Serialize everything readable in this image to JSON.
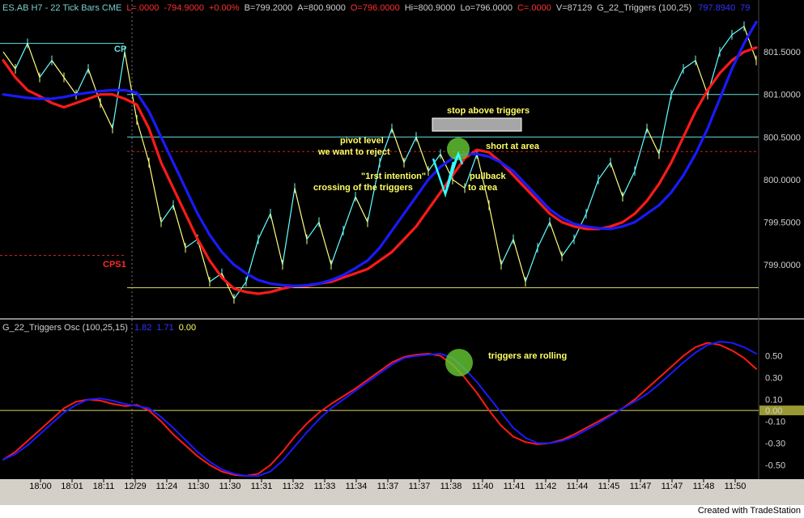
{
  "header": {
    "symbol": "ES.AB H7 - 22 Tick Bars  CME",
    "last": "L=.0000",
    "change": "-794.9000",
    "pct": "+0.00%",
    "bid": "B=799.2000",
    "ask": "A=800.9000",
    "open": "O=796.0000",
    "high": "Hi=800.9000",
    "low": "Lo=796.0000",
    "close": "C=.0000",
    "volume": "V=87129",
    "study": "G_22_Triggers  (100,25)",
    "study_v1": "797.8940",
    "study_v2": "79"
  },
  "osc_header": {
    "title": "G_22_Triggers Osc  (100,25,15)",
    "v1": "1.82",
    "v2": "1.71",
    "v3": "0.00"
  },
  "footer": {
    "credit": "Created with TradeStation"
  },
  "colors": {
    "bg": "#000000",
    "price_up": "#66ffff",
    "price_down": "#ffff80",
    "trigger_fast": "#ff1a1a",
    "trigger_slow": "#1a1aff",
    "level_cyan": "#66e0e0",
    "level_yellow": "#d8d860",
    "pivot_red": "#cc2222",
    "highlight_green": "#66cc33"
  },
  "chart_data": [
    {
      "type": "line",
      "panel": "price",
      "price_axis": [
        "801.5000",
        "801.0000",
        "800.5000",
        "800.0000",
        "799.5000",
        "799.0000"
      ],
      "time_axis": [
        "18:00",
        "18:01",
        "18:11",
        "12/29",
        "11:24",
        "11:30",
        "11:30",
        "11:31",
        "11:32",
        "11:33",
        "11:34",
        "11:37",
        "11:37",
        "11:38",
        "11:40",
        "11:41",
        "11:42",
        "11:44",
        "11:45",
        "11:47",
        "11:47",
        "11:48",
        "11:50"
      ],
      "ylim": [
        798.45,
        801.9
      ],
      "levels": [
        {
          "label": "CP",
          "price": 801.6,
          "style": "solid",
          "color": "#66e0e0",
          "extent": "left"
        },
        {
          "label": "",
          "price": 801.0,
          "style": "solid",
          "color": "#66e0e0",
          "extent": "right"
        },
        {
          "label": "",
          "price": 800.5,
          "style": "solid",
          "color": "#66e0e0",
          "extent": "right"
        },
        {
          "label": "",
          "price": 800.33,
          "style": "dashed",
          "color": "#cc2222",
          "extent": "right"
        },
        {
          "label": "CPS1",
          "price": 799.11,
          "style": "dashed",
          "color": "#cc2222",
          "extent": "left"
        },
        {
          "label": "",
          "price": 798.73,
          "style": "solid",
          "color": "#d8d860",
          "extent": "right"
        }
      ],
      "series": [
        {
          "color": "#ff1a1a",
          "values": [
            801.4,
            801.2,
            801.05,
            800.98,
            800.9,
            800.85,
            800.9,
            800.95,
            801.0,
            801.0,
            800.95,
            800.88,
            800.6,
            800.2,
            799.9,
            799.6,
            799.3,
            799.05,
            798.85,
            798.72,
            798.68,
            798.66,
            798.68,
            798.72,
            798.75,
            798.75,
            798.78,
            798.8,
            798.85,
            798.9,
            798.95,
            799.05,
            799.15,
            799.3,
            799.45,
            799.65,
            799.85,
            800.05,
            800.25,
            800.35,
            800.32,
            800.2,
            800.05,
            799.9,
            799.75,
            799.6,
            799.5,
            799.45,
            799.42,
            799.42,
            799.45,
            799.5,
            799.6,
            799.75,
            799.95,
            800.2,
            800.5,
            800.8,
            801.05,
            801.25,
            801.4,
            801.5,
            801.55
          ]
        },
        {
          "color": "#1a1aff",
          "values": [
            801.0,
            800.98,
            800.96,
            800.95,
            800.95,
            800.97,
            801.0,
            801.02,
            801.04,
            801.05,
            801.05,
            801.02,
            800.8,
            800.5,
            800.2,
            799.9,
            799.6,
            799.35,
            799.15,
            799.0,
            798.9,
            798.82,
            798.78,
            798.76,
            798.75,
            798.76,
            798.78,
            798.82,
            798.88,
            798.96,
            799.05,
            799.2,
            799.4,
            799.6,
            799.8,
            800.0,
            800.15,
            800.25,
            800.3,
            800.3,
            800.27,
            800.2,
            800.1,
            799.95,
            799.8,
            799.65,
            799.55,
            799.48,
            799.45,
            799.43,
            799.42,
            799.45,
            799.5,
            799.6,
            799.7,
            799.85,
            800.05,
            800.3,
            800.6,
            800.95,
            801.3,
            801.6,
            801.85
          ]
        },
        {
          "color": "#66ffff",
          "values": [
            801.5,
            801.3,
            801.6,
            801.2,
            801.4,
            801.2,
            801.0,
            801.3,
            800.9,
            800.6,
            801.5,
            800.7,
            800.2,
            799.5,
            799.7,
            799.2,
            799.3,
            798.8,
            798.9,
            798.6,
            798.8,
            799.3,
            799.6,
            799.0,
            799.9,
            799.3,
            799.5,
            799.0,
            799.4,
            799.8,
            799.5,
            800.2,
            800.6,
            800.2,
            800.5,
            800.1,
            800.3,
            800.0,
            799.9,
            800.3,
            799.7,
            799.0,
            799.3,
            798.8,
            799.2,
            799.5,
            799.1,
            799.3,
            799.6,
            800.0,
            800.2,
            799.8,
            800.1,
            800.6,
            800.3,
            801.0,
            801.3,
            801.4,
            801.0,
            801.5,
            801.7,
            801.8,
            801.4
          ]
        }
      ]
    },
    {
      "type": "line",
      "panel": "oscillator",
      "y_axis": [
        "0.50",
        "0.30",
        "0.10",
        "0.00",
        "-0.10",
        "-0.30",
        "-0.50"
      ],
      "ylim": [
        -0.6,
        0.72
      ],
      "zero_line": 0.0,
      "series": [
        {
          "color": "#ff1a1a",
          "values": [
            -0.45,
            -0.38,
            -0.28,
            -0.18,
            -0.08,
            0.02,
            0.08,
            0.1,
            0.09,
            0.06,
            0.04,
            0.05,
            0.0,
            -0.1,
            -0.22,
            -0.32,
            -0.42,
            -0.5,
            -0.56,
            -0.59,
            -0.6,
            -0.58,
            -0.5,
            -0.38,
            -0.24,
            -0.12,
            -0.02,
            0.06,
            0.13,
            0.2,
            0.28,
            0.36,
            0.44,
            0.49,
            0.51,
            0.52,
            0.5,
            0.42,
            0.3,
            0.16,
            0.0,
            -0.14,
            -0.24,
            -0.29,
            -0.31,
            -0.3,
            -0.27,
            -0.22,
            -0.16,
            -0.1,
            -0.04,
            0.02,
            0.1,
            0.2,
            0.3,
            0.4,
            0.5,
            0.58,
            0.62,
            0.6,
            0.55,
            0.48,
            0.38
          ]
        },
        {
          "color": "#1a1aff",
          "values": [
            -0.45,
            -0.4,
            -0.32,
            -0.22,
            -0.12,
            -0.02,
            0.05,
            0.1,
            0.11,
            0.09,
            0.06,
            0.04,
            0.02,
            -0.06,
            -0.16,
            -0.27,
            -0.38,
            -0.47,
            -0.54,
            -0.58,
            -0.6,
            -0.6,
            -0.56,
            -0.46,
            -0.33,
            -0.2,
            -0.08,
            0.02,
            0.1,
            0.18,
            0.26,
            0.34,
            0.42,
            0.48,
            0.5,
            0.51,
            0.52,
            0.48,
            0.38,
            0.26,
            0.12,
            -0.02,
            -0.16,
            -0.25,
            -0.3,
            -0.3,
            -0.28,
            -0.24,
            -0.18,
            -0.12,
            -0.05,
            0.02,
            0.08,
            0.15,
            0.24,
            0.34,
            0.44,
            0.53,
            0.6,
            0.63,
            0.62,
            0.58,
            0.52
          ]
        }
      ]
    }
  ],
  "annotations": {
    "cp_label": "CP",
    "cps1_label": "CPS1",
    "stop_above": "stop above triggers",
    "pivot_line1": "pivot level",
    "pivot_line2": "we want to reject",
    "short_at_area": "short at area",
    "first_intention": "\"1rst intention\"",
    "crossing": "crossing of the triggers",
    "pullback_line1": "pullback",
    "pullback_line2": "to area",
    "triggers_rolling": "triggers are rolling"
  }
}
